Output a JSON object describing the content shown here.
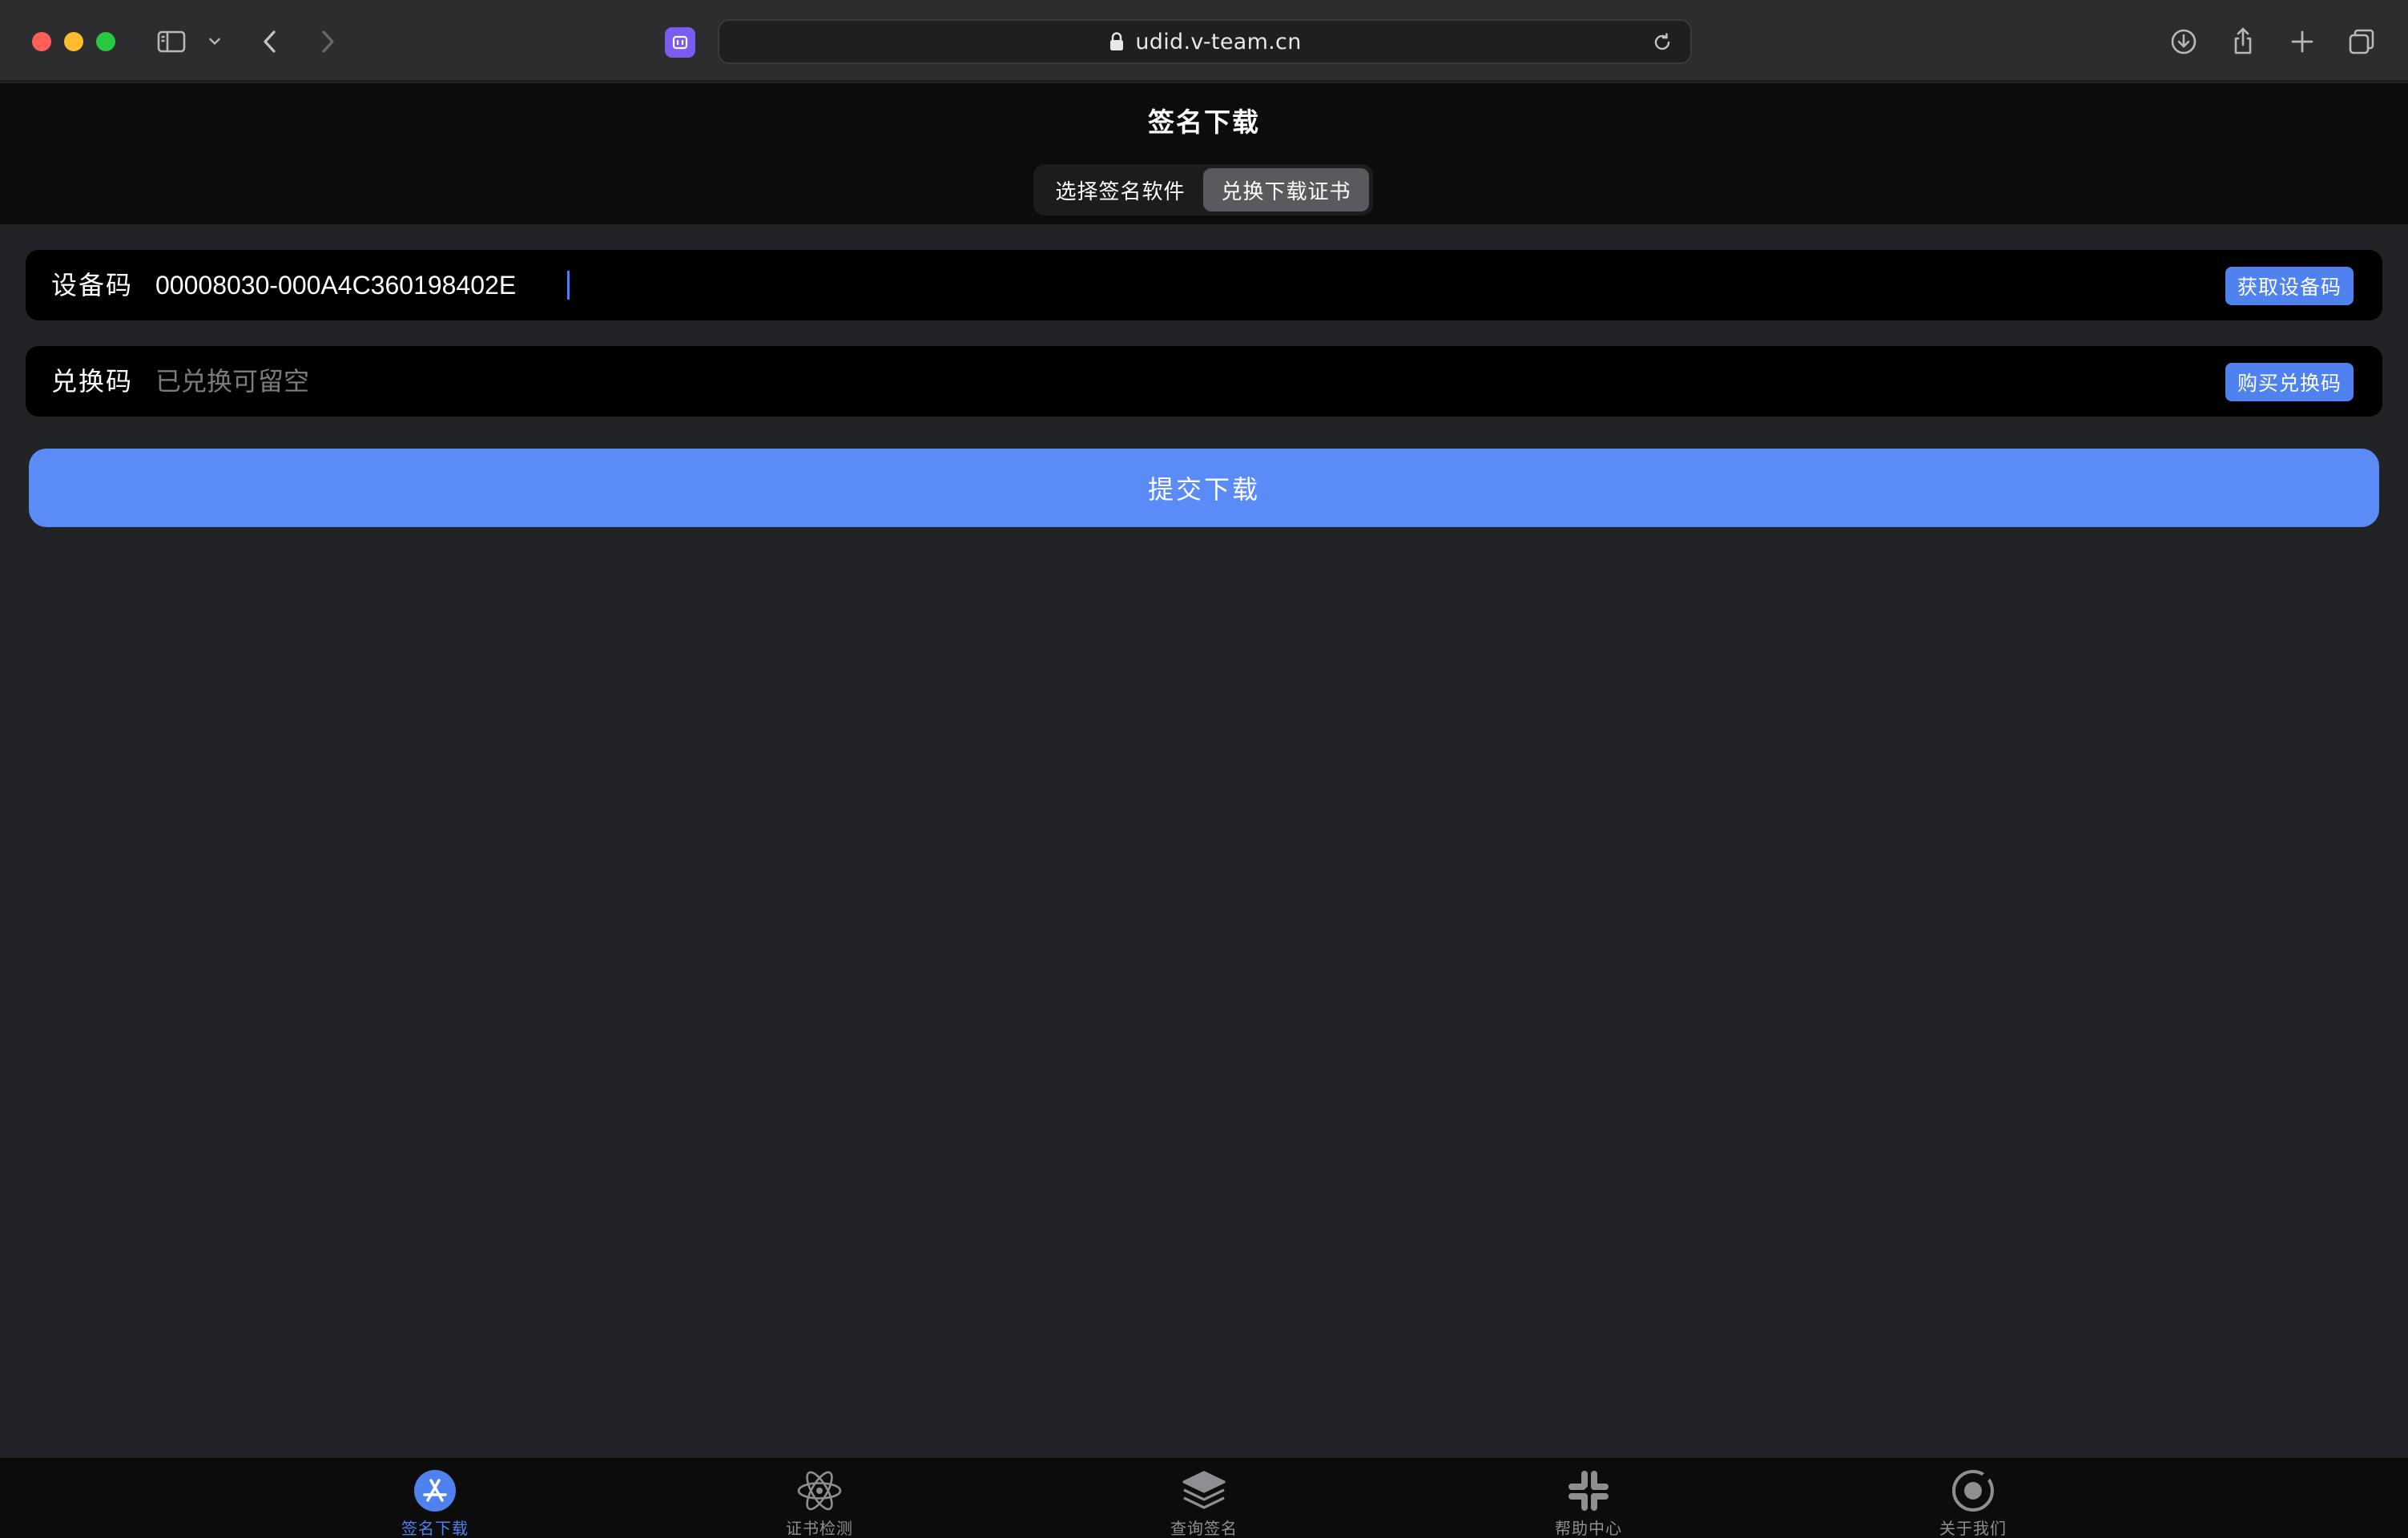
{
  "browser": {
    "url": "udid.v-team.cn"
  },
  "header": {
    "title": "签名下载",
    "segments": [
      {
        "label": "选择签名软件",
        "active": false
      },
      {
        "label": "兑换下载证书",
        "active": true
      }
    ]
  },
  "form": {
    "device": {
      "label": "设备码",
      "value": "00008030-000A4C360198402E",
      "button_label": "获取设备码"
    },
    "redeem": {
      "label": "兑换码",
      "value": "",
      "placeholder": "已兑换可留空",
      "button_label": "购买兑换码"
    },
    "submit_label": "提交下载"
  },
  "tabbar": {
    "items": [
      {
        "label": "签名下载",
        "icon": "app-store-icon",
        "active": true
      },
      {
        "label": "证书检测",
        "icon": "atom-icon",
        "active": false
      },
      {
        "label": "查询签名",
        "icon": "layers-icon",
        "active": false
      },
      {
        "label": "帮助中心",
        "icon": "slack-icon",
        "active": false
      },
      {
        "label": "关于我们",
        "icon": "target-icon",
        "active": false
      }
    ]
  },
  "colors": {
    "accent": "#5b8bf6",
    "button": "#4f82ee",
    "background": "#222327",
    "header_bg": "#0c0c0d",
    "field_bg": "#000000"
  }
}
